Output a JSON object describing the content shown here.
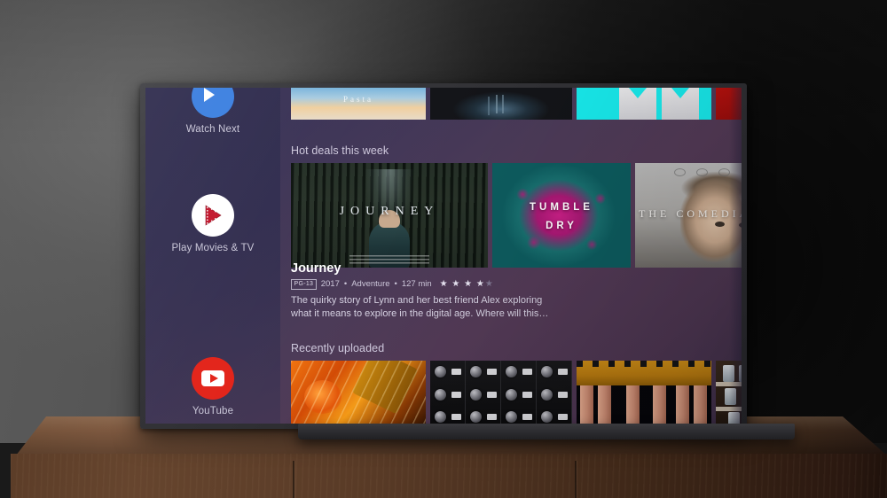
{
  "scene": {
    "description": "Android TV home screen displayed on a flat-screen television standing on a wooden credenza against a grey wall",
    "wall_color": "#565656",
    "credenza_color": "#5c3d28"
  },
  "tv": {
    "bezel_color": "#2b2b2f",
    "ui_background": "#4a3a57",
    "sidebar_background": "#2f2c4e"
  },
  "sidebar": {
    "items": [
      {
        "label": "Watch Next",
        "icon": "watch-next-icon",
        "color": "#3b7fe0"
      },
      {
        "label": "Play Movies & TV",
        "icon": "play-movies-icon",
        "color": "#c2152b"
      },
      {
        "label": "YouTube",
        "icon": "youtube-icon",
        "color": "#e32319"
      }
    ]
  },
  "rows": {
    "top": {
      "tiles": [
        {
          "name": "pasta-tile",
          "caption": "Pasta"
        },
        {
          "name": "forest-night-tile",
          "caption": ""
        },
        {
          "name": "cyan-shirts-tile",
          "caption": ""
        },
        {
          "name": "red-tile",
          "caption": ""
        }
      ]
    },
    "hot_deals": {
      "title": "Hot deals this week",
      "tiles": [
        {
          "name": "journey-tile",
          "caption": "JOURNEY"
        },
        {
          "name": "tumble-dry-tile",
          "caption_line1": "TUMBLE",
          "caption_line2": "DRY"
        },
        {
          "name": "the-comedian-tile",
          "caption": "THE COMEDIAN"
        }
      ]
    },
    "recently_uploaded": {
      "title": "Recently uploaded",
      "tiles": [
        {
          "name": "guitar-tile"
        },
        {
          "name": "audio-rack-tile"
        },
        {
          "name": "rail-tile"
        },
        {
          "name": "shelf-tile"
        }
      ]
    }
  },
  "detail": {
    "title": "Journey",
    "content_rating": "PG-13",
    "year": "2017",
    "genre": "Adventure",
    "duration": "127 min",
    "meta_separator": "•",
    "stars_filled": "★ ★ ★ ★",
    "stars_empty": "★",
    "description": "The quirky story of Lynn and her best friend Alex exploring what it means to explore in the digital age. Where will this…"
  }
}
